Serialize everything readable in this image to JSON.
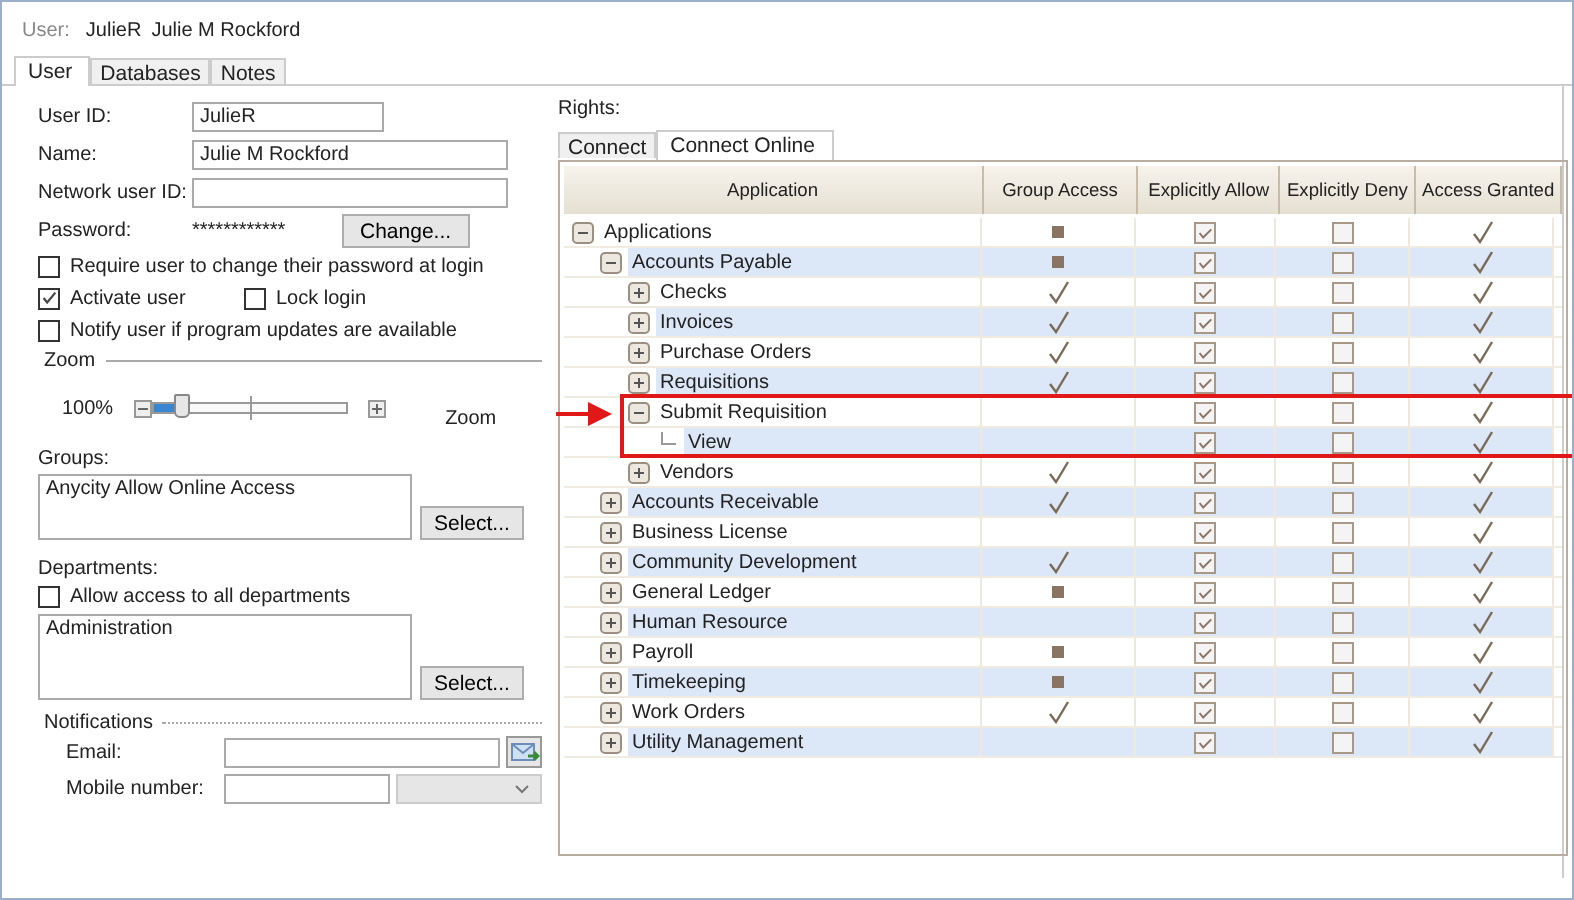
{
  "header": {
    "label": "User:",
    "user_id": "JulieR",
    "full_name": "Julie M Rockford"
  },
  "tabs": [
    {
      "label": "User",
      "selected": true
    },
    {
      "label": "Databases",
      "selected": false
    },
    {
      "label": "Notes",
      "selected": false
    }
  ],
  "form": {
    "user_id_label": "User ID:",
    "user_id": "JulieR",
    "name_label": "Name:",
    "name": "Julie M Rockford",
    "network_label": "Network user ID:",
    "password_label": "Password:",
    "password": "************",
    "change_button": "Change...",
    "options": [
      {
        "label": "Require user to change their password at login",
        "checked": false
      },
      {
        "label": "Activate user",
        "checked": true
      },
      {
        "label": "Lock login",
        "checked": false
      },
      {
        "label": "Notify user if program updates are available",
        "checked": false
      }
    ],
    "zoom_section": "Zoom",
    "zoom_value": "100%",
    "zoom_slider": {
      "level": 0.15
    },
    "zoom_label": "Zoom",
    "groups_label": "Groups:",
    "groups": [
      "Anycity Allow Online Access"
    ],
    "groups_select": "Select...",
    "departments_label": "Departments:",
    "all_departments": {
      "label": "Allow access to all departments",
      "checked": false
    },
    "departments": [
      "Administration"
    ],
    "departments_select": "Select...",
    "notifications_section": "Notifications",
    "email_label": "Email:",
    "mobile_label": "Mobile number:"
  },
  "rights": {
    "label": "Rights:",
    "tabs": [
      {
        "label": "Connect",
        "selected": false
      },
      {
        "label": "Connect Online",
        "selected": true
      }
    ],
    "columns": [
      "Application",
      "Group Access",
      "Explicitly Allow",
      "Explicitly Deny",
      "Access Granted"
    ],
    "rows": [
      {
        "name": "Applications",
        "group_access": {
          "kind": "partial"
        },
        "allow": true,
        "deny": false,
        "granted": true,
        "expanded": true,
        "highlighted": false,
        "children": [
          {
            "name": "Accounts Payable",
            "group_access": {
              "kind": "partial"
            },
            "allow": true,
            "deny": false,
            "granted": true,
            "expanded": true,
            "highlighted": false,
            "children": [
              {
                "name": "Checks",
                "group_access": {
                  "kind": "check"
                },
                "allow": true,
                "deny": false,
                "granted": true,
                "expanded": false,
                "highlighted": false
              },
              {
                "name": "Invoices",
                "group_access": {
                  "kind": "check"
                },
                "allow": true,
                "deny": false,
                "granted": true,
                "expanded": false,
                "highlighted": false
              },
              {
                "name": "Purchase Orders",
                "group_access": {
                  "kind": "check"
                },
                "allow": true,
                "deny": false,
                "granted": true,
                "expanded": false,
                "highlighted": false
              },
              {
                "name": "Requisitions",
                "group_access": {
                  "kind": "check"
                },
                "allow": true,
                "deny": false,
                "granted": true,
                "expanded": false,
                "highlighted": false
              },
              {
                "name": "Submit Requisition",
                "group_access": {
                  "kind": "empty"
                },
                "allow": true,
                "deny": false,
                "granted": true,
                "expanded": true,
                "highlighted": true,
                "children": [
                  {
                    "name": "View",
                    "allow": true,
                    "deny": false,
                    "granted": true,
                    "highlighted": true
                  }
                ]
              },
              {
                "name": "Vendors",
                "group_access": {
                  "kind": "check"
                },
                "allow": true,
                "deny": false,
                "granted": true,
                "expanded": false,
                "highlighted": false
              }
            ]
          },
          {
            "name": "Accounts Receivable",
            "group_access": {
              "kind": "check"
            },
            "allow": true,
            "deny": false,
            "granted": true,
            "expanded": false,
            "highlighted": false
          },
          {
            "name": "Business License",
            "group_access": {
              "kind": "empty"
            },
            "allow": true,
            "deny": false,
            "granted": true,
            "expanded": false,
            "highlighted": false
          },
          {
            "name": "Community Development",
            "group_access": {
              "kind": "check"
            },
            "allow": true,
            "deny": false,
            "granted": true,
            "expanded": false,
            "highlighted": false
          },
          {
            "name": "General Ledger",
            "group_access": {
              "kind": "partial"
            },
            "allow": true,
            "deny": false,
            "granted": true,
            "expanded": false,
            "highlighted": false
          },
          {
            "name": "Human Resource",
            "group_access": {
              "kind": "empty"
            },
            "allow": true,
            "deny": false,
            "granted": true,
            "expanded": false,
            "highlighted": false
          },
          {
            "name": "Payroll",
            "group_access": {
              "kind": "partial"
            },
            "allow": true,
            "deny": false,
            "granted": true,
            "expanded": false,
            "highlighted": false
          },
          {
            "name": "Timekeeping",
            "group_access": {
              "kind": "partial"
            },
            "allow": true,
            "deny": false,
            "granted": true,
            "expanded": false,
            "highlighted": false
          },
          {
            "name": "Work Orders",
            "group_access": {
              "kind": "check"
            },
            "allow": true,
            "deny": false,
            "granted": true,
            "expanded": false,
            "highlighted": false
          },
          {
            "name": "Utility Management",
            "group_access": {
              "kind": "empty"
            },
            "allow": true,
            "deny": false,
            "granted": true,
            "expanded": false,
            "highlighted": false
          }
        ]
      }
    ]
  }
}
